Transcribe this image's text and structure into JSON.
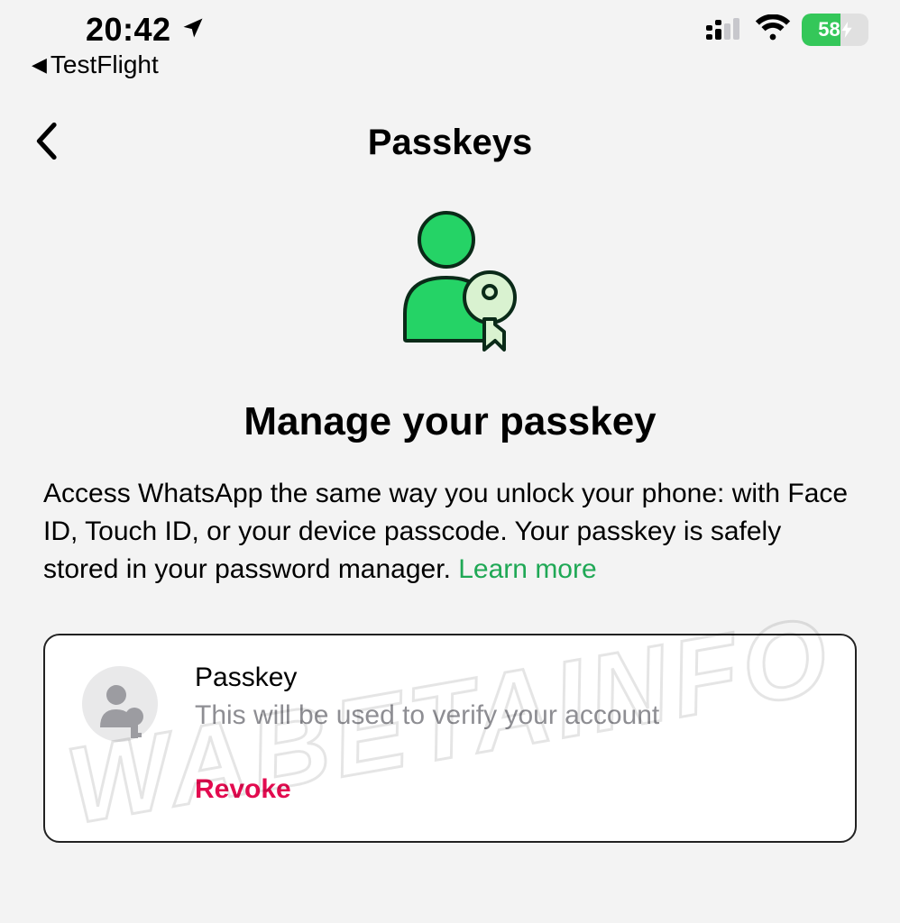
{
  "status": {
    "time": "20:42",
    "breadcrumb": "TestFlight",
    "battery_percent": "58"
  },
  "header": {
    "title": "Passkeys"
  },
  "hero": {
    "heading": "Manage your passkey",
    "body": "Access WhatsApp the same way you unlock your phone: with Face ID, Touch ID, or your device passcode. Your passkey is safely stored in your password manager. ",
    "learn_more": "Learn more"
  },
  "card": {
    "title": "Passkey",
    "subtitle": "This will be used to verify your account",
    "revoke_label": "Revoke"
  },
  "watermark": "WABETAINFO",
  "colors": {
    "accent_green": "#1fa855",
    "battery_green": "#34c759",
    "danger": "#e30b4f"
  }
}
